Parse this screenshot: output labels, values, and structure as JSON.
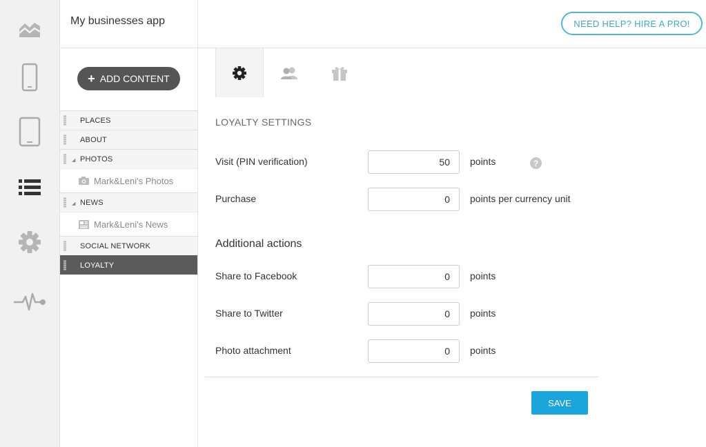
{
  "rail": {
    "items": [
      {
        "icon": "analytics-icon"
      },
      {
        "icon": "phone-icon"
      },
      {
        "icon": "tablet-icon"
      },
      {
        "icon": "content-list-icon"
      },
      {
        "icon": "settings-gear-icon"
      },
      {
        "icon": "pulse-activity-icon"
      }
    ]
  },
  "app": {
    "title": "My businesses app"
  },
  "tree": {
    "add_content_label": "ADD CONTENT",
    "items": [
      {
        "label": "PLACES"
      },
      {
        "label": "ABOUT"
      },
      {
        "label": "PHOTOS",
        "child": "Mark&Leni's Photos"
      },
      {
        "label": "NEWS",
        "child": "Mark&Leni's News"
      },
      {
        "label": "SOCIAL NETWORK"
      },
      {
        "label": "LOYALTY",
        "active": true
      }
    ]
  },
  "header": {
    "help_button": "NEED HELP? HIRE A PRO!"
  },
  "tabs": [
    {
      "icon": "gear-icon",
      "active": true
    },
    {
      "icon": "users-icon"
    },
    {
      "icon": "gift-icon"
    }
  ],
  "form": {
    "section_title": "LOYALTY SETTINGS",
    "visit": {
      "label": "Visit (PIN verification)",
      "value": "50",
      "unit": "points"
    },
    "purchase": {
      "label": "Purchase",
      "value": "0",
      "unit": "points per currency unit"
    },
    "additional_title": "Additional actions",
    "facebook": {
      "label": "Share to Facebook",
      "value": "0",
      "unit": "points"
    },
    "twitter": {
      "label": "Share to Twitter",
      "value": "0",
      "unit": "points"
    },
    "photo": {
      "label": "Photo attachment",
      "value": "0",
      "unit": "points"
    },
    "help_glyph": "?",
    "save_label": "SAVE"
  },
  "colors": {
    "accent": "#1aa6dd",
    "help_border": "#4fb9d0",
    "active_row": "#5b5b5b",
    "rail_bg": "#f1f1f1"
  }
}
